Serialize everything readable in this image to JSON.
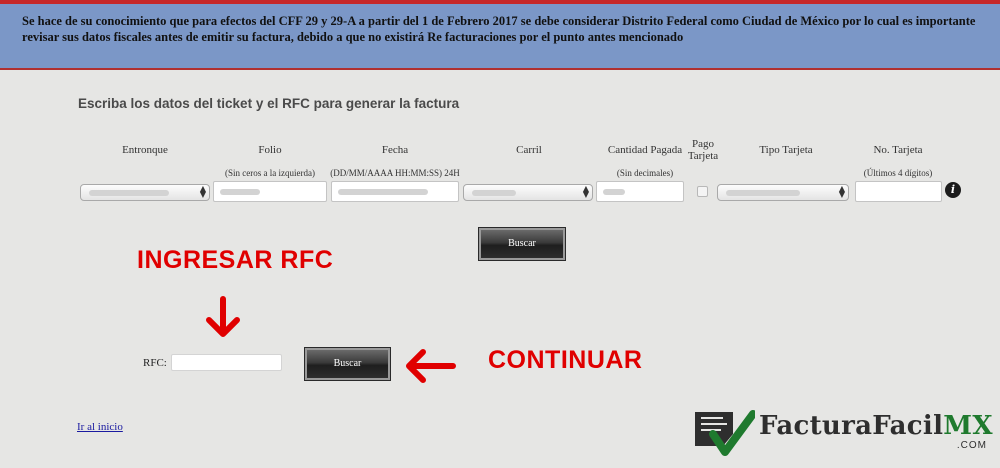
{
  "notice": {
    "text": "Se hace de su conocimiento que para efectos del CFF 29 y 29-A a partir del 1 de Febrero 2017 se debe considerar Distrito Federal como Ciudad de México por lo cual es importante revisar sus datos fiscales antes de emitir su factura, debido a que no existirá Re facturaciones por el punto antes mencionado"
  },
  "form": {
    "heading": "Escriba los datos del ticket y el RFC para generar la factura",
    "columns": {
      "entronque": "Entronque",
      "folio": "Folio",
      "folio_hint": "(Sin ceros a la izquierda)",
      "fecha": "Fecha",
      "fecha_hint": "(DD/MM/AAAA HH:MM:SS) 24H",
      "carril": "Carril",
      "cantidad": "Cantidad Pagada",
      "cantidad_hint": "(Sin decimales)",
      "pago_line1": "Pago",
      "pago_line2": "Tarjeta",
      "tipo_tarjeta": "Tipo Tarjeta",
      "no_tarjeta": "No. Tarjeta",
      "no_tarjeta_hint": "(Últimos 4 dígitos)"
    },
    "search_button": "Buscar"
  },
  "annotations": {
    "ingresar_rfc": "INGRESAR RFC",
    "continuar": "CONTINUAR"
  },
  "rfc": {
    "label": "RFC:",
    "button": "Buscar"
  },
  "footer": {
    "home_link": "Ir al inicio"
  },
  "logo": {
    "name_main": "FacturaFacil",
    "name_mx": "MX",
    "domain": ".COM"
  },
  "icons": {
    "info": "info-icon",
    "arrow_down": "arrow-down-icon",
    "arrow_left": "arrow-left-icon",
    "select_arrows": "select-arrows-icon"
  },
  "colors": {
    "notice_bg": "#7b97c7",
    "accent_red": "#e00000",
    "logo_green": "#1f7a2e"
  }
}
